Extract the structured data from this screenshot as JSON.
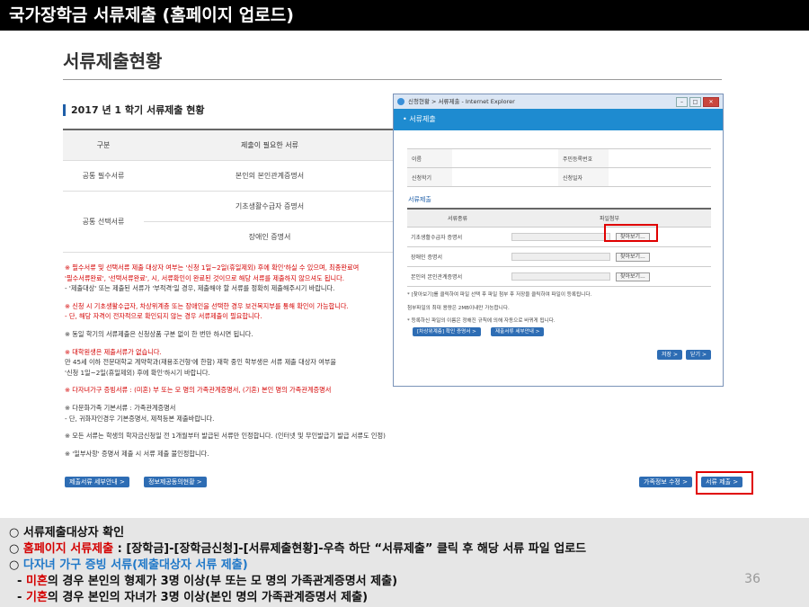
{
  "slide_title": "국가장학금 서류제출 (홈페이지 업로드)",
  "page_title": "서류제출현황",
  "section_head": "2017 년 1 학기 서류제출 현황",
  "docs_table": {
    "headers": [
      "구분",
      "제출이 필요한 서류"
    ],
    "rows": [
      {
        "group": "공통 필수서류",
        "doc": "본인의 본인관계증명서"
      },
      {
        "group": "공통 선택서류",
        "doc": "기초생활수급자 증명서"
      },
      {
        "group": "",
        "doc": "장애인 증명서"
      }
    ]
  },
  "notes": [
    "※ 필수서류 및 선택서류 제출 대상자 여부는 '신청 1일~2일(휴일제외) 후에 확인'하실 수 있으며, 최종완료여",
    "  '필수서류완료', '선택서류완료', 시, 서류확인이 완료된 것이므로 해당 서류를 제출하지 않으셔도 됩니다.",
    "- '제출대상' 또는 제출된 서류가 '부적격'일 경우, 제출해야 할 서류를 정확히 제출해주시기 바랍니다.",
    "※ 신청 시 기초생활수급자, 차상위계층 또는 장애인을 선택한 경우 보건복지부를 통해 확인이 가능합니다.",
    "- 단, 해당 자격이 전자적으로 확인되지 않는 경우 서류제출이 필요합니다.",
    "※ 동일 학기의 서류제출은 신청상품 구분 없이 한 번만 하시면 됩니다.",
    "※ 대학원생은 제출서류가 없습니다.",
    "   만 45세 이하 전문대학교 계약학과(재용조건형'에 한함) 재학 중인 학부생은 서류 제출 대상자 여부을",
    "   '신청 1일~2일(휴일제외) 후에 확인'하시기 바랍니다.",
    "※ 다자녀가구 증빙서류 : (미혼) 부 또는 모 명의 가족관계증명서, (기혼) 본인 명의 가족관계증명서",
    "※ 다문화가족 기본서류 : 가족관계증명서",
    "- 단, 귀화자인경우 기본증명서, 제적등본 제출바랍니다.",
    "※ 모든 서류는 학생의 학자금신청일 전 1개월부터 발급된 서류만 인정합니다. (인터넷 및 무인발급기 발급 서류도 인정)",
    "※ '일부사항' 증명서 제출 시 서류 제출 불인정합니다."
  ],
  "bottom_buttons": {
    "doc_info": "제출서류 세부안내 >",
    "info_agree": "정보제공동의현황 >",
    "family_edit": "가족정보 수정 >",
    "submit": "서류 제출 >"
  },
  "popup": {
    "window_title": "신청현황 > 서류제출 - Internet Explorer",
    "header": "• 서류제출",
    "info_labels": [
      "이름",
      "주민등록번호",
      "신청학기",
      "신청일자"
    ],
    "sub_title": "서류제출",
    "file_headers": [
      "서류종류",
      "파일첨부"
    ],
    "files": [
      "기초생활수급자 증명서",
      "장애인 증명서",
      "본인의 본인관계증명서"
    ],
    "find_label": "찾아보기...",
    "notes": [
      "* [찾아보기]를 클릭하여 파일 선택 후 파일 첨부 후 저장을 클릭하여 파일이 등록됩니다.",
      "  첨부파일의 최대 용량은 2MB이내만 가능합니다.",
      "* 등록하신 파일의 이름은 정해진 규칙에 의해 자동으로 바뀌게 됩니다."
    ],
    "chip1": "[차상위계층] 확인 증명서 >",
    "chip2": "제출서류 세부안내 >",
    "save": "저장 >",
    "close": "닫기 >"
  },
  "footer": {
    "line1": "○ 서류제출대상자 확인",
    "line2_prefix": "○ ",
    "line2_red": "홈페이지 서류제출",
    "line2_rest": " : [장학금]-[장학금신청]-[서류제출현황]-우측 하단 “서류제출” 클릭 후 해당 서류 파일 업로드",
    "line3_prefix": "○ ",
    "line3_blue": "다자녀 가구 증빙 서류(제출대상자 서류 제출)",
    "line4_prefix": "  - ",
    "line4_red": "미혼",
    "line4_rest": "의 경우 본인의 형제가 3명 이상(부 또는 모 명의 가족관계증명서 제출)",
    "line5_prefix": "  - ",
    "line5_red": "기혼",
    "line5_rest": "의 경우 본인의 자녀가 3명 이상(본인 명의 가족관계증명서 제출)",
    "page_number": "36"
  },
  "colors": {
    "accent_blue": "#1f78c8",
    "alert_red": "#d40000",
    "highlight_box": "#e00000"
  }
}
